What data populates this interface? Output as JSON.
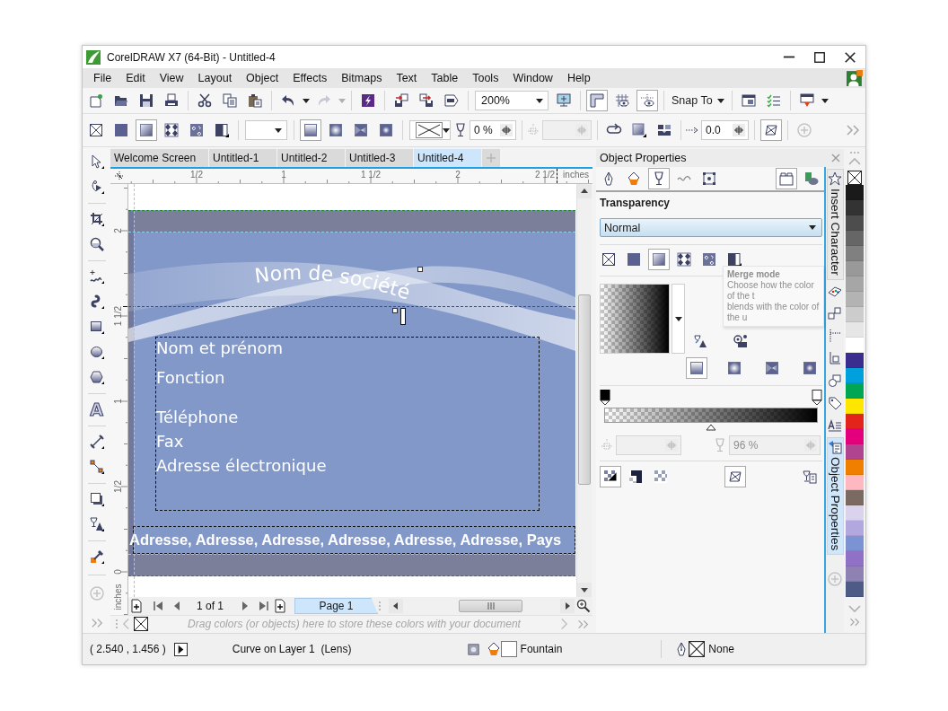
{
  "window": {
    "title": "CorelDRAW X7 (64-Bit) - Untitled-4"
  },
  "menu": [
    "File",
    "Edit",
    "View",
    "Layout",
    "Object",
    "Effects",
    "Bitmaps",
    "Text",
    "Table",
    "Tools",
    "Window",
    "Help"
  ],
  "standard_toolbar": {
    "redo_disabled": true,
    "zoom_level": "200%",
    "rulers_on": true,
    "grid_on": false,
    "guidelines_on": true,
    "snap_to": "Snap To"
  },
  "property_bar": {
    "transparency_types": [
      {
        "kind": "none",
        "selected": false
      },
      {
        "kind": "uniform",
        "selected": false
      },
      {
        "kind": "fountain",
        "selected": true
      },
      {
        "kind": "vector",
        "selected": false
      },
      {
        "kind": "bitmap",
        "selected": false
      },
      {
        "kind": "twocolor",
        "selected": false
      }
    ],
    "fountain_types": [
      {
        "kind": "linear",
        "selected": true
      },
      {
        "kind": "elliptical",
        "selected": false
      },
      {
        "kind": "conical",
        "selected": false
      },
      {
        "kind": "rectangular",
        "selected": false
      }
    ],
    "transparency_field": {
      "value": "0 %",
      "disabled": false
    },
    "node_position_field": {
      "disabled": true
    },
    "acceleration": "0.0",
    "free_scale_and_skew": true
  },
  "toolbox": {
    "text_tool_label": "A"
  },
  "document_tabs": [
    {
      "label": "Welcome Screen",
      "selected": false
    },
    {
      "label": "Untitled-1",
      "selected": false
    },
    {
      "label": "Untitled-2",
      "selected": false
    },
    {
      "label": "Untitled-3",
      "selected": false
    },
    {
      "label": "Untitled-4",
      "selected": true
    }
  ],
  "horizontal_ruler": {
    "labels": [
      "1/2",
      "1",
      "1 1/2",
      "2",
      "2 1/2"
    ],
    "unit": "inches"
  },
  "vertical_ruler": {
    "labels": [
      "2",
      "1 1/2",
      "1",
      "1/2",
      "0"
    ],
    "unit": "inches"
  },
  "page": {
    "company": "Nom de société",
    "name_block": [
      "Nom et prénom",
      "Fonction"
    ],
    "contact_block": [
      "Téléphone",
      "Fax",
      "Adresse électronique"
    ],
    "address": "Adresse, Adresse, Adresse, Adresse, Adresse, Adresse, Pays"
  },
  "page_navigator": {
    "counter": "1 of 1",
    "pages": [
      {
        "label": "Page 1",
        "selected": true
      }
    ]
  },
  "document_palette": {
    "hint": "Drag colors (or objects) here to store these colors with your document"
  },
  "docker": {
    "title": "Object Properties",
    "property_tabs": [
      {
        "kind": "outline",
        "selected": false
      },
      {
        "kind": "fill",
        "selected": false
      },
      {
        "kind": "transparency",
        "selected": true
      },
      {
        "kind": "curve",
        "selected": false
      },
      {
        "kind": "summary",
        "selected": false
      }
    ],
    "panel_toggle_on": true,
    "section": "Transparency",
    "merge_mode": "Normal",
    "tooltip": {
      "title": "Merge mode",
      "lines": [
        "Choose how the color of the t",
        "blends with the color of the u"
      ]
    },
    "transparency_types": [
      {
        "kind": "none",
        "selected": false
      },
      {
        "kind": "uniform",
        "selected": false
      },
      {
        "kind": "fountain",
        "selected": true
      },
      {
        "kind": "vector",
        "selected": false
      },
      {
        "kind": "bitmap",
        "selected": false
      },
      {
        "kind": "twocolor",
        "selected": false
      }
    ],
    "fountain_types": [
      {
        "kind": "linear",
        "selected": true
      },
      {
        "kind": "elliptical",
        "selected": false
      },
      {
        "kind": "conical",
        "selected": false
      },
      {
        "kind": "rectangular",
        "selected": false
      }
    ],
    "midpoint": {
      "level": 0.5
    },
    "node_position_field": {
      "disabled": true
    },
    "transparency_field": {
      "value": "96 %",
      "disabled": true
    },
    "repeat_modes": [
      {
        "kind": "default",
        "selected": true
      },
      {
        "kind": "mirror",
        "selected": false
      },
      {
        "kind": "repeat",
        "selected": false
      }
    ],
    "free_scale_and_skew": true
  },
  "docker_tabs": [
    {
      "label": "Insert Character",
      "selected": false
    },
    {
      "label": "Object Properties",
      "selected": true
    }
  ],
  "palette": [
    {
      "color": "#1a1a1a"
    },
    {
      "color": "#333333"
    },
    {
      "color": "#4d4d4d"
    },
    {
      "color": "#666666"
    },
    {
      "color": "#808080"
    },
    {
      "color": "#999999"
    },
    {
      "color": "#a6a6a6"
    },
    {
      "color": "#b3b3b3"
    },
    {
      "color": "#cccccc"
    },
    {
      "color": "#e6e6e6"
    },
    {
      "color": "#ffffff"
    },
    {
      "color": "#3a2d8f"
    },
    {
      "color": "#00a0dc"
    },
    {
      "color": "#00a651"
    },
    {
      "color": "#ffe600"
    },
    {
      "color": "#e2241b"
    },
    {
      "color": "#e4007c"
    },
    {
      "color": "#b0448f"
    },
    {
      "color": "#f07f00"
    },
    {
      "color": "#ffb7c0"
    },
    {
      "color": "#7b6a62"
    },
    {
      "color": "#d9d3ee"
    },
    {
      "color": "#b3a7df"
    },
    {
      "color": "#7b93d2"
    },
    {
      "color": "#8f72c6"
    },
    {
      "color": "#8f81b1"
    },
    {
      "color": "#4d5b86"
    }
  ],
  "status_bar": {
    "coordinates": "( 2.540 , 1.456 )",
    "object": "Curve on Layer 1  (Lens)",
    "fill": "Fountain",
    "outline": "None"
  }
}
